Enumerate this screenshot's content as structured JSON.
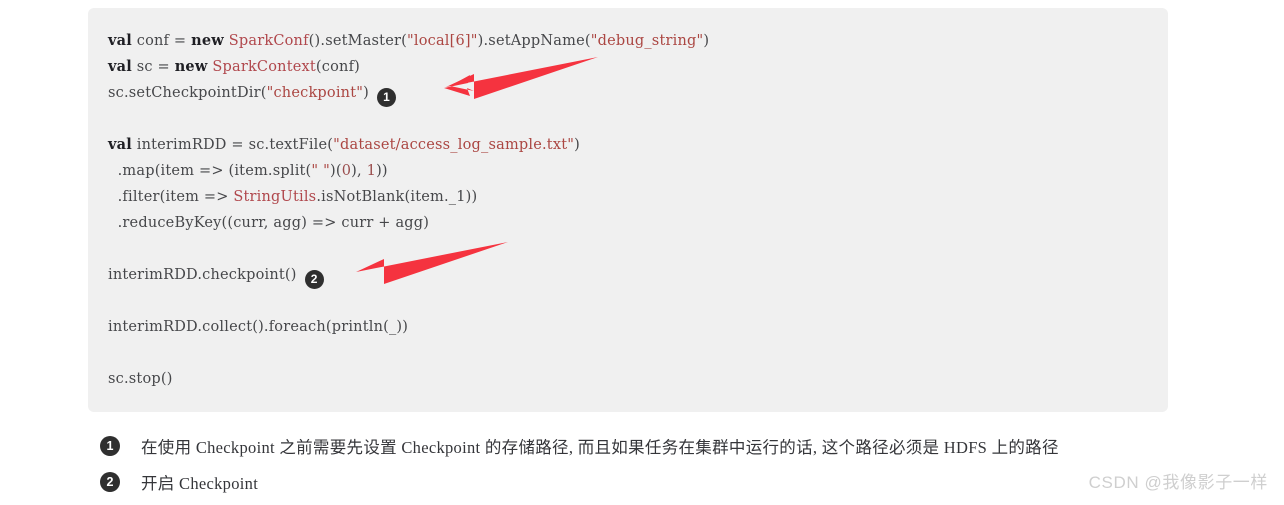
{
  "colors": {
    "page_background": "#ffffff",
    "code_background": "#f0f0f0",
    "code_text": "#46474a",
    "keyword": "#1f1f24",
    "type_name": "#b0474c",
    "string": "#ab4642",
    "arrow": "#f5333f",
    "badge_background": "#2f2f2f",
    "badge_text": "#ffffff",
    "footnote_text": "#35363a",
    "watermark": "#cfcfcf"
  },
  "code_block": {
    "language": "scala",
    "lines": [
      {
        "id": "line-1",
        "tokens": [
          {
            "t": "val",
            "c": "kw"
          },
          {
            "t": " conf = ",
            "c": "plain"
          },
          {
            "t": "new",
            "c": "kw"
          },
          {
            "t": " ",
            "c": "plain"
          },
          {
            "t": "SparkConf",
            "c": "type"
          },
          {
            "t": "().setMaster(",
            "c": "plain"
          },
          {
            "t": "\"local[6]\"",
            "c": "str"
          },
          {
            "t": ").setAppName(",
            "c": "plain"
          },
          {
            "t": "\"debug_string\"",
            "c": "str"
          },
          {
            "t": ")",
            "c": "plain"
          }
        ],
        "badge": null
      },
      {
        "id": "line-2",
        "tokens": [
          {
            "t": "val",
            "c": "kw"
          },
          {
            "t": " sc = ",
            "c": "plain"
          },
          {
            "t": "new",
            "c": "kw"
          },
          {
            "t": " ",
            "c": "plain"
          },
          {
            "t": "SparkContext",
            "c": "type"
          },
          {
            "t": "(conf)",
            "c": "plain"
          }
        ],
        "badge": null
      },
      {
        "id": "line-3",
        "tokens": [
          {
            "t": "sc.setCheckpointDir(",
            "c": "plain"
          },
          {
            "t": "\"checkpoint\"",
            "c": "str"
          },
          {
            "t": ")",
            "c": "plain"
          }
        ],
        "badge": "1"
      },
      {
        "id": "line-4",
        "tokens": [],
        "badge": null
      },
      {
        "id": "line-5",
        "tokens": [
          {
            "t": "val",
            "c": "kw"
          },
          {
            "t": " interimRDD = sc.textFile(",
            "c": "plain"
          },
          {
            "t": "\"dataset/access_log_sample.txt\"",
            "c": "str"
          },
          {
            "t": ")",
            "c": "plain"
          }
        ],
        "badge": null
      },
      {
        "id": "line-6",
        "tokens": [
          {
            "t": "  .map(item => (item.split(",
            "c": "plain"
          },
          {
            "t": "\" \"",
            "c": "str"
          },
          {
            "t": ")(",
            "c": "plain"
          },
          {
            "t": "0",
            "c": "num"
          },
          {
            "t": "), ",
            "c": "plain"
          },
          {
            "t": "1",
            "c": "num"
          },
          {
            "t": "))",
            "c": "plain"
          }
        ],
        "badge": null
      },
      {
        "id": "line-7",
        "tokens": [
          {
            "t": "  .filter(item => ",
            "c": "plain"
          },
          {
            "t": "StringUtils",
            "c": "type"
          },
          {
            "t": ".isNotBlank(item._1))",
            "c": "plain"
          }
        ],
        "badge": null
      },
      {
        "id": "line-8",
        "tokens": [
          {
            "t": "  .reduceByKey((curr, agg) => curr + agg)",
            "c": "plain"
          }
        ],
        "badge": null
      },
      {
        "id": "line-9",
        "tokens": [],
        "badge": null
      },
      {
        "id": "line-10",
        "tokens": [
          {
            "t": "interimRDD.checkpoint()",
            "c": "plain"
          }
        ],
        "badge": "2"
      },
      {
        "id": "line-11",
        "tokens": [],
        "badge": null
      },
      {
        "id": "line-12",
        "tokens": [
          {
            "t": "interimRDD.collect().foreach(println(_))",
            "c": "plain"
          }
        ],
        "badge": null
      },
      {
        "id": "line-13",
        "tokens": [],
        "badge": null
      },
      {
        "id": "line-14",
        "tokens": [
          {
            "t": "sc.stop()",
            "c": "plain"
          }
        ],
        "badge": null
      }
    ]
  },
  "annotations": {
    "arrows": [
      {
        "id": "arrow-1",
        "color": "#f5333f",
        "points_to": "setCheckpointDir-line"
      },
      {
        "id": "arrow-2",
        "color": "#f5333f",
        "points_to": "checkpoint-call-line"
      }
    ]
  },
  "footnotes": [
    {
      "number": "1",
      "text": "在使用 Checkpoint 之前需要先设置 Checkpoint 的存储路径, 而且如果任务在集群中运行的话, 这个路径必须是 HDFS 上的路径"
    },
    {
      "number": "2",
      "text": "开启 Checkpoint"
    }
  ],
  "watermark": {
    "text": "CSDN @我像影子一样"
  }
}
